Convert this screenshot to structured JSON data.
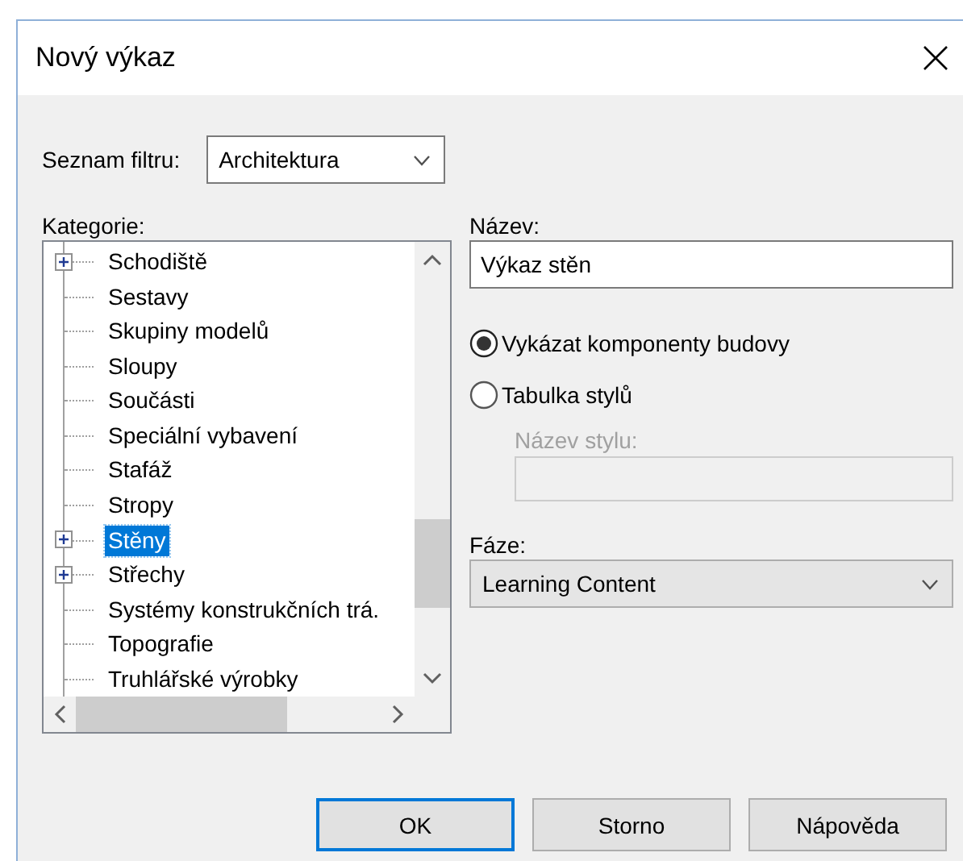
{
  "window": {
    "title": "Nový výkaz"
  },
  "filter": {
    "label": "Seznam filtru:",
    "value": "Architektura"
  },
  "categories": {
    "label": "Kategorie:",
    "items": [
      {
        "label": "Schodiště",
        "expandable": true,
        "selected": false
      },
      {
        "label": "Sestavy",
        "expandable": false,
        "selected": false
      },
      {
        "label": "Skupiny modelů",
        "expandable": false,
        "selected": false
      },
      {
        "label": "Sloupy",
        "expandable": false,
        "selected": false
      },
      {
        "label": "Součásti",
        "expandable": false,
        "selected": false
      },
      {
        "label": "Speciální vybavení",
        "expandable": false,
        "selected": false
      },
      {
        "label": "Stafáž",
        "expandable": false,
        "selected": false
      },
      {
        "label": "Stropy",
        "expandable": false,
        "selected": false
      },
      {
        "label": "Stěny",
        "expandable": true,
        "selected": true
      },
      {
        "label": "Střechy",
        "expandable": true,
        "selected": false
      },
      {
        "label": "Systémy konstrukčních trá.",
        "expandable": false,
        "selected": false
      },
      {
        "label": "Topografie",
        "expandable": false,
        "selected": false
      },
      {
        "label": "Truhlářské výrobky",
        "expandable": false,
        "selected": false
      }
    ]
  },
  "name": {
    "label": "Název:",
    "value": "Výkaz stěn"
  },
  "radios": [
    {
      "label": "Vykázat komponenty budovy",
      "selected": true
    },
    {
      "label": "Tabulka stylů",
      "selected": false
    }
  ],
  "style_name": {
    "label": "Název stylu:",
    "disabled": true
  },
  "phase": {
    "label": "Fáze:",
    "value": "Learning Content"
  },
  "buttons": [
    {
      "label": "OK",
      "default": true
    },
    {
      "label": "Storno",
      "default": false
    },
    {
      "label": "Nápověda",
      "default": false
    }
  ]
}
